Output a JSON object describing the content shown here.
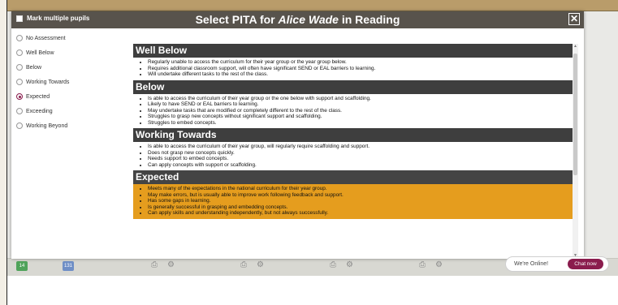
{
  "modal": {
    "title_prefix": "Select PITA for",
    "pupil_name": "Alice Wade",
    "title_suffix": "in Reading",
    "mark_multiple_label": "Mark multiple pupils",
    "close_symbol": "✕"
  },
  "options": [
    {
      "label": "No Assessment",
      "selected": false
    },
    {
      "label": "Well Below",
      "selected": false
    },
    {
      "label": "Below",
      "selected": false
    },
    {
      "label": "Working Towards",
      "selected": false
    },
    {
      "label": "Expected",
      "selected": true
    },
    {
      "label": "Exceeding",
      "selected": false
    },
    {
      "label": "Working Beyond",
      "selected": false
    }
  ],
  "sections": [
    {
      "title": "Well Below",
      "items": [
        "Regularly unable to access the curriculum for their year group or the year group below.",
        "Requires additional classroom support, will often have significant SEND or EAL barriers to learning.",
        "Will undertake different tasks to the rest of the class."
      ]
    },
    {
      "title": "Below",
      "items": [
        "Is able to access the curriculum of their year group or the one below with support and scaffolding.",
        "Likely to have SEND or EAL barriers to learning.",
        "May undertake tasks that are modified or completely different to the rest of the class.",
        "Struggles to grasp new concepts without significant support and scaffolding.",
        "Struggles to embed concepts."
      ]
    },
    {
      "title": "Working Towards",
      "items": [
        "Is able to access the curriculum of their year group, will regularly require scaffolding and support.",
        "Does not grasp new concepts quickly.",
        "Needs support to embed concepts.",
        "Can apply concepts with support or scaffolding."
      ]
    },
    {
      "title": "Expected",
      "items": [
        "Meets many of the expectations in the national curriculum for their year group.",
        "May make errors, but is usually able to improve work following feedback and support.",
        "Has some gaps in learning.",
        "Is generally successful in grasping and embedding concepts.",
        "Can apply skills and understanding independently, but not always successfully."
      ]
    }
  ],
  "chat": {
    "status": "We're Online!",
    "button": "Chat now"
  },
  "bottom_bar": {
    "chip_green": "14",
    "chip_blue": "131"
  },
  "colors": {
    "header_bg": "#58534c",
    "section_head_bg": "#3e3e3e",
    "expected_bg": "#e59d1e",
    "accent": "#8a1c4d"
  }
}
